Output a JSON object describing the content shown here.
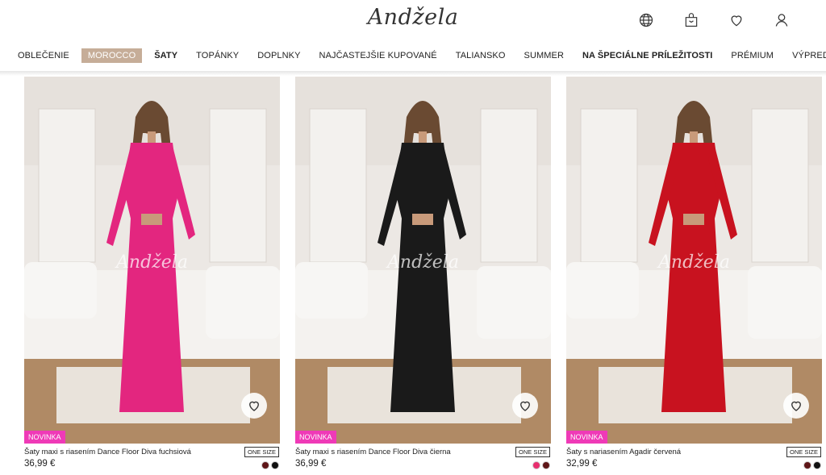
{
  "header": {
    "logo": "Andžela",
    "icons": [
      "globe-icon",
      "bag-icon",
      "heart-icon",
      "user-icon"
    ]
  },
  "nav": {
    "items": [
      {
        "label": "OBLEČENIE",
        "active": false,
        "bold": false
      },
      {
        "label": "MOROCCO",
        "active": true,
        "bold": false
      },
      {
        "label": "ŠATY",
        "active": false,
        "bold": true
      },
      {
        "label": "TOPÁNKY",
        "active": false,
        "bold": false
      },
      {
        "label": "DOPLNKY",
        "active": false,
        "bold": false
      },
      {
        "label": "NAJČASTEJŠIE KUPOVANÉ",
        "active": false,
        "bold": false
      },
      {
        "label": "TALIANSKO",
        "active": false,
        "bold": false
      },
      {
        "label": "SUMMER",
        "active": false,
        "bold": false
      },
      {
        "label": "NA ŠPECIÁLNE PRÍLEŽITOSTI",
        "active": false,
        "bold": true
      },
      {
        "label": "PRÉMIUM",
        "active": false,
        "bold": false
      },
      {
        "label": "VÝPREDAJ",
        "active": false,
        "bold": false
      }
    ]
  },
  "products": [
    {
      "name": "Šaty maxi s riasením Dance Floor Diva fuchsiová",
      "price": "36,99 €",
      "badge": "NOVINKA",
      "size": "ONE SIZE",
      "watermark": "Andžela",
      "dress_color": "#e3267f",
      "swatches": [
        "#5e1517",
        "#111111"
      ]
    },
    {
      "name": "Šaty maxi s riasením Dance Floor Diva čierna",
      "price": "36,99 €",
      "badge": "NOVINKA",
      "size": "ONE SIZE",
      "watermark": "Andžela",
      "dress_color": "#1a1a1a",
      "swatches": [
        "#e82f6f",
        "#5e1517"
      ]
    },
    {
      "name": "Šaty s nariasením Agadir červená",
      "price": "32,99 €",
      "badge": "NOVINKA",
      "size": "ONE SIZE",
      "watermark": "Andžela",
      "dress_color": "#c8121f",
      "swatches": [
        "#5e1517",
        "#111111"
      ]
    }
  ]
}
